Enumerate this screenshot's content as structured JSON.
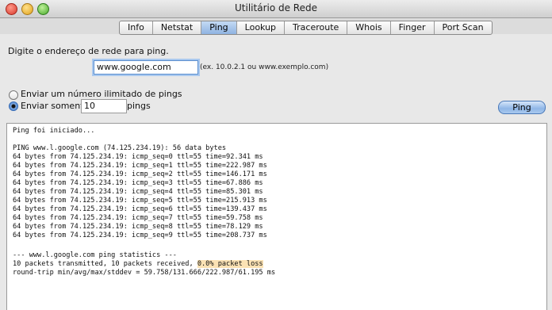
{
  "window": {
    "title": "Utilitário de Rede"
  },
  "tabs": [
    {
      "label": "Info"
    },
    {
      "label": "Netstat"
    },
    {
      "label": "Ping"
    },
    {
      "label": "Lookup"
    },
    {
      "label": "Traceroute"
    },
    {
      "label": "Whois"
    },
    {
      "label": "Finger"
    },
    {
      "label": "Port Scan"
    }
  ],
  "active_tab": "Ping",
  "form": {
    "prompt": "Digite o endereço de rede para ping.",
    "address_value": "www.google.com",
    "example_hint": "(ex. 10.0.2.1 ou www.exemplo.com)",
    "option_unlimited": "Enviar um número ilimitado de pings",
    "option_limited": "Enviar somente",
    "count_value": "10",
    "count_suffix": "pings",
    "selected_option": "limited",
    "ping_button": "Ping"
  },
  "output": {
    "started": "Ping foi iniciado...",
    "header": "PING www.l.google.com (74.125.234.19): 56 data bytes",
    "replies": [
      "64 bytes from 74.125.234.19: icmp_seq=0 ttl=55 time=92.341 ms",
      "64 bytes from 74.125.234.19: icmp_seq=1 ttl=55 time=222.987 ms",
      "64 bytes from 74.125.234.19: icmp_seq=2 ttl=55 time=146.171 ms",
      "64 bytes from 74.125.234.19: icmp_seq=3 ttl=55 time=67.886 ms",
      "64 bytes from 74.125.234.19: icmp_seq=4 ttl=55 time=85.301 ms",
      "64 bytes from 74.125.234.19: icmp_seq=5 ttl=55 time=215.913 ms",
      "64 bytes from 74.125.234.19: icmp_seq=6 ttl=55 time=139.437 ms",
      "64 bytes from 74.125.234.19: icmp_seq=7 ttl=55 time=59.758 ms",
      "64 bytes from 74.125.234.19: icmp_seq=8 ttl=55 time=78.129 ms",
      "64 bytes from 74.125.234.19: icmp_seq=9 ttl=55 time=208.737 ms"
    ],
    "stats_header": "--- www.l.google.com ping statistics ---",
    "stats_line_prefix": "10 packets transmitted, 10 packets received, ",
    "packet_loss": "0.0% packet loss",
    "rtt_line": "round-trip min/avg/max/stddev = 59.758/131.666/222.987/61.195 ms"
  },
  "colors": {
    "highlight": "#fbe2b4",
    "accent": "#8fb3e1"
  }
}
